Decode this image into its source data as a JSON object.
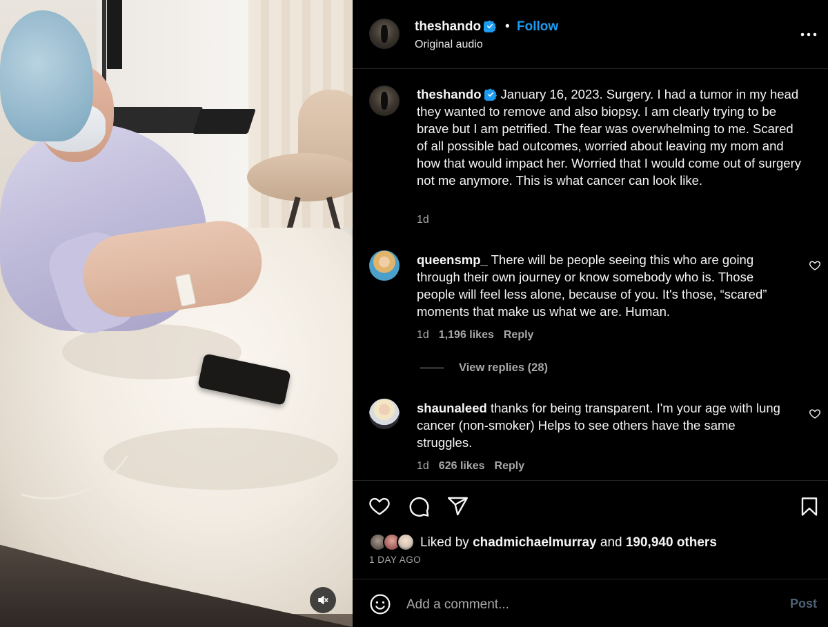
{
  "header": {
    "username": "theshando",
    "separator": "•",
    "follow_label": "Follow",
    "audio": "Original audio"
  },
  "caption": {
    "username": "theshando",
    "text": "January 16, 2023. Surgery. I had a tumor in my head they wanted to remove and also biopsy. I am clearly trying to be brave but I am petrified. The fear was overwhelming to me. Scared of all possible bad outcomes, worried about leaving my mom and how that would impact her. Worried that I would come out of surgery not me anymore. This is what cancer can look like.",
    "age": "1d"
  },
  "comments": [
    {
      "username": "queensmp_",
      "text": "There will be people seeing this who are going through their own journey or know somebody who is. Those people will feel less alone, because of you. It's those, “scared” moments that make us what we are. Human.",
      "age": "1d",
      "likes": "1,196 likes",
      "reply_label": "Reply"
    },
    {
      "username": "shaunaleed",
      "text": "thanks for being transparent. I'm your age with lung cancer (non-smoker) Helps to see others have the same struggles.",
      "age": "1d",
      "likes": "626 likes",
      "reply_label": "Reply"
    }
  ],
  "view_replies": "View replies (28)",
  "likes_summary": {
    "prefix": "Liked by",
    "user": "chadmichaelmurray",
    "connector": "and",
    "others": "190,940 others"
  },
  "timestamp": "1 DAY AGO",
  "composer": {
    "placeholder": "Add a comment...",
    "post_label": "Post"
  },
  "colors": {
    "link_blue": "#1d9bf0",
    "post_disabled": "#4f6378",
    "muted_text": "#a8a8a8"
  },
  "icons": [
    "verified-badge-icon",
    "more-options-icon",
    "heart-icon",
    "comment-icon",
    "share-icon",
    "save-icon",
    "emoji-icon",
    "mute-icon"
  ]
}
